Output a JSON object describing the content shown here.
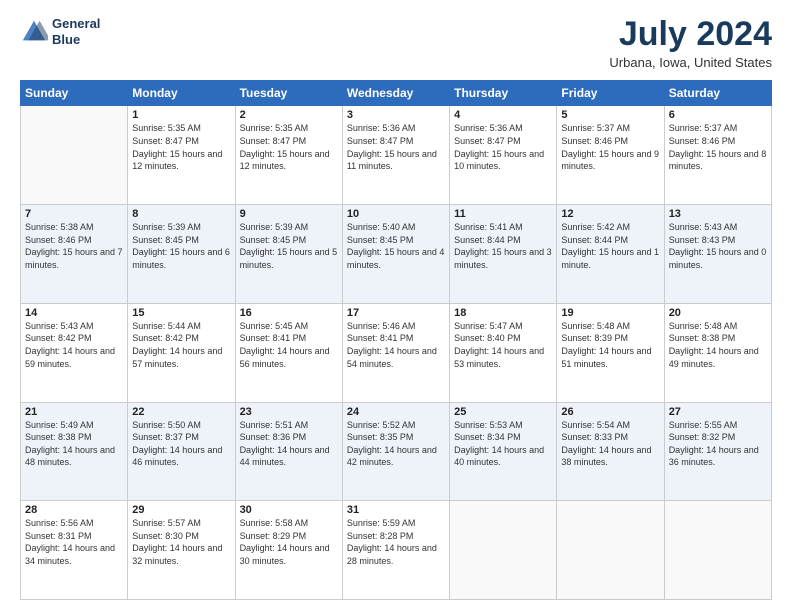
{
  "logo": {
    "line1": "General",
    "line2": "Blue"
  },
  "title": "July 2024",
  "subtitle": "Urbana, Iowa, United States",
  "days_of_week": [
    "Sunday",
    "Monday",
    "Tuesday",
    "Wednesday",
    "Thursday",
    "Friday",
    "Saturday"
  ],
  "weeks": [
    [
      {
        "day": "",
        "sunrise": "",
        "sunset": "",
        "daylight": ""
      },
      {
        "day": "1",
        "sunrise": "Sunrise: 5:35 AM",
        "sunset": "Sunset: 8:47 PM",
        "daylight": "Daylight: 15 hours and 12 minutes."
      },
      {
        "day": "2",
        "sunrise": "Sunrise: 5:35 AM",
        "sunset": "Sunset: 8:47 PM",
        "daylight": "Daylight: 15 hours and 12 minutes."
      },
      {
        "day": "3",
        "sunrise": "Sunrise: 5:36 AM",
        "sunset": "Sunset: 8:47 PM",
        "daylight": "Daylight: 15 hours and 11 minutes."
      },
      {
        "day": "4",
        "sunrise": "Sunrise: 5:36 AM",
        "sunset": "Sunset: 8:47 PM",
        "daylight": "Daylight: 15 hours and 10 minutes."
      },
      {
        "day": "5",
        "sunrise": "Sunrise: 5:37 AM",
        "sunset": "Sunset: 8:46 PM",
        "daylight": "Daylight: 15 hours and 9 minutes."
      },
      {
        "day": "6",
        "sunrise": "Sunrise: 5:37 AM",
        "sunset": "Sunset: 8:46 PM",
        "daylight": "Daylight: 15 hours and 8 minutes."
      }
    ],
    [
      {
        "day": "7",
        "sunrise": "Sunrise: 5:38 AM",
        "sunset": "Sunset: 8:46 PM",
        "daylight": "Daylight: 15 hours and 7 minutes."
      },
      {
        "day": "8",
        "sunrise": "Sunrise: 5:39 AM",
        "sunset": "Sunset: 8:45 PM",
        "daylight": "Daylight: 15 hours and 6 minutes."
      },
      {
        "day": "9",
        "sunrise": "Sunrise: 5:39 AM",
        "sunset": "Sunset: 8:45 PM",
        "daylight": "Daylight: 15 hours and 5 minutes."
      },
      {
        "day": "10",
        "sunrise": "Sunrise: 5:40 AM",
        "sunset": "Sunset: 8:45 PM",
        "daylight": "Daylight: 15 hours and 4 minutes."
      },
      {
        "day": "11",
        "sunrise": "Sunrise: 5:41 AM",
        "sunset": "Sunset: 8:44 PM",
        "daylight": "Daylight: 15 hours and 3 minutes."
      },
      {
        "day": "12",
        "sunrise": "Sunrise: 5:42 AM",
        "sunset": "Sunset: 8:44 PM",
        "daylight": "Daylight: 15 hours and 1 minute."
      },
      {
        "day": "13",
        "sunrise": "Sunrise: 5:43 AM",
        "sunset": "Sunset: 8:43 PM",
        "daylight": "Daylight: 15 hours and 0 minutes."
      }
    ],
    [
      {
        "day": "14",
        "sunrise": "Sunrise: 5:43 AM",
        "sunset": "Sunset: 8:42 PM",
        "daylight": "Daylight: 14 hours and 59 minutes."
      },
      {
        "day": "15",
        "sunrise": "Sunrise: 5:44 AM",
        "sunset": "Sunset: 8:42 PM",
        "daylight": "Daylight: 14 hours and 57 minutes."
      },
      {
        "day": "16",
        "sunrise": "Sunrise: 5:45 AM",
        "sunset": "Sunset: 8:41 PM",
        "daylight": "Daylight: 14 hours and 56 minutes."
      },
      {
        "day": "17",
        "sunrise": "Sunrise: 5:46 AM",
        "sunset": "Sunset: 8:41 PM",
        "daylight": "Daylight: 14 hours and 54 minutes."
      },
      {
        "day": "18",
        "sunrise": "Sunrise: 5:47 AM",
        "sunset": "Sunset: 8:40 PM",
        "daylight": "Daylight: 14 hours and 53 minutes."
      },
      {
        "day": "19",
        "sunrise": "Sunrise: 5:48 AM",
        "sunset": "Sunset: 8:39 PM",
        "daylight": "Daylight: 14 hours and 51 minutes."
      },
      {
        "day": "20",
        "sunrise": "Sunrise: 5:48 AM",
        "sunset": "Sunset: 8:38 PM",
        "daylight": "Daylight: 14 hours and 49 minutes."
      }
    ],
    [
      {
        "day": "21",
        "sunrise": "Sunrise: 5:49 AM",
        "sunset": "Sunset: 8:38 PM",
        "daylight": "Daylight: 14 hours and 48 minutes."
      },
      {
        "day": "22",
        "sunrise": "Sunrise: 5:50 AM",
        "sunset": "Sunset: 8:37 PM",
        "daylight": "Daylight: 14 hours and 46 minutes."
      },
      {
        "day": "23",
        "sunrise": "Sunrise: 5:51 AM",
        "sunset": "Sunset: 8:36 PM",
        "daylight": "Daylight: 14 hours and 44 minutes."
      },
      {
        "day": "24",
        "sunrise": "Sunrise: 5:52 AM",
        "sunset": "Sunset: 8:35 PM",
        "daylight": "Daylight: 14 hours and 42 minutes."
      },
      {
        "day": "25",
        "sunrise": "Sunrise: 5:53 AM",
        "sunset": "Sunset: 8:34 PM",
        "daylight": "Daylight: 14 hours and 40 minutes."
      },
      {
        "day": "26",
        "sunrise": "Sunrise: 5:54 AM",
        "sunset": "Sunset: 8:33 PM",
        "daylight": "Daylight: 14 hours and 38 minutes."
      },
      {
        "day": "27",
        "sunrise": "Sunrise: 5:55 AM",
        "sunset": "Sunset: 8:32 PM",
        "daylight": "Daylight: 14 hours and 36 minutes."
      }
    ],
    [
      {
        "day": "28",
        "sunrise": "Sunrise: 5:56 AM",
        "sunset": "Sunset: 8:31 PM",
        "daylight": "Daylight: 14 hours and 34 minutes."
      },
      {
        "day": "29",
        "sunrise": "Sunrise: 5:57 AM",
        "sunset": "Sunset: 8:30 PM",
        "daylight": "Daylight: 14 hours and 32 minutes."
      },
      {
        "day": "30",
        "sunrise": "Sunrise: 5:58 AM",
        "sunset": "Sunset: 8:29 PM",
        "daylight": "Daylight: 14 hours and 30 minutes."
      },
      {
        "day": "31",
        "sunrise": "Sunrise: 5:59 AM",
        "sunset": "Sunset: 8:28 PM",
        "daylight": "Daylight: 14 hours and 28 minutes."
      },
      {
        "day": "",
        "sunrise": "",
        "sunset": "",
        "daylight": ""
      },
      {
        "day": "",
        "sunrise": "",
        "sunset": "",
        "daylight": ""
      },
      {
        "day": "",
        "sunrise": "",
        "sunset": "",
        "daylight": ""
      }
    ]
  ]
}
